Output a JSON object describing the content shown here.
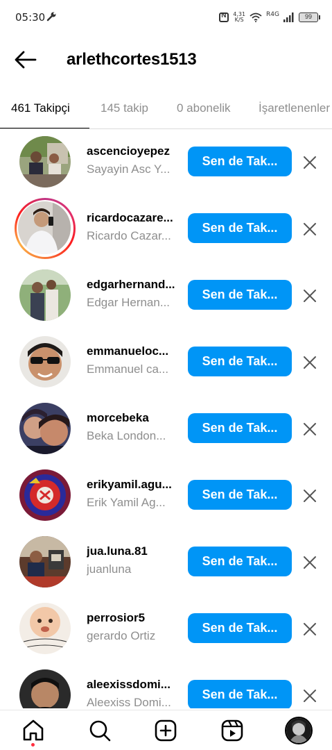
{
  "status_bar": {
    "time": "05:30",
    "speed_value": "4,31",
    "speed_unit": "K/S",
    "network": "R4G",
    "battery": "99"
  },
  "header": {
    "title": "arlethcortes1513",
    "back_icon": "back-arrow-icon"
  },
  "tabs": [
    {
      "label": "461 Takipçi",
      "active": true
    },
    {
      "label": "145 takip",
      "active": false
    },
    {
      "label": "0 abonelik",
      "active": false
    },
    {
      "label": "İşaretlenenler",
      "active": false
    }
  ],
  "follow_button_label": "Sen de Tak...",
  "followers": [
    {
      "username": "ascencioyepez",
      "name": "Sayayin Asc Y..."
    },
    {
      "username": "ricardocazare...",
      "name": "Ricardo Cazar..."
    },
    {
      "username": "edgarhernand...",
      "name": "Edgar Hernan..."
    },
    {
      "username": "emmanueloc...",
      "name": "Emmanuel ca..."
    },
    {
      "username": "morcebeka",
      "name": "Beka London..."
    },
    {
      "username": "erikyamil.agu...",
      "name": "Erik Yamil Ag..."
    },
    {
      "username": "jua.luna.81",
      "name": "juanluna"
    },
    {
      "username": "perrosior5",
      "name": "gerardo Ortiz"
    },
    {
      "username": "aleexissdomi...",
      "name": "Aleexiss Domi..."
    }
  ],
  "bottom_nav": [
    "home-icon",
    "search-icon",
    "create-icon",
    "reels-icon",
    "profile-avatar"
  ],
  "colors": {
    "accent": "#0095f6",
    "muted_text": "#8e8e8e",
    "notification_dot": "#ff3040"
  }
}
